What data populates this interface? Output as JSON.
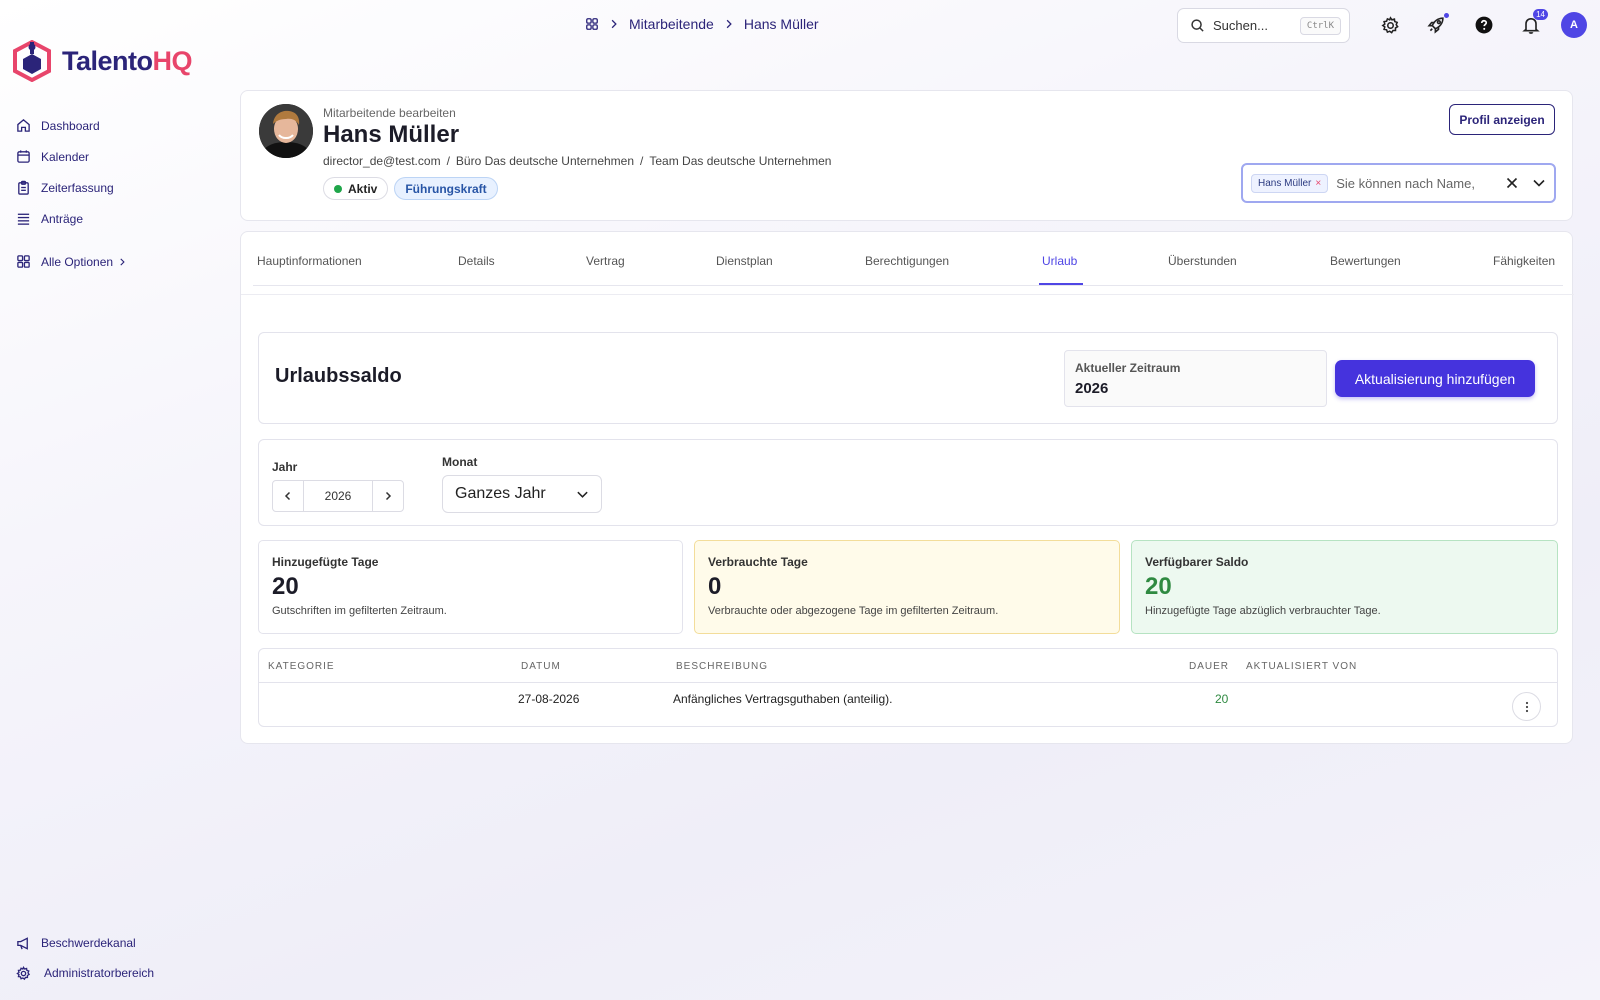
{
  "brand": {
    "name_part1": "Talento",
    "name_part2": "HQ"
  },
  "sidebar": {
    "items": [
      {
        "label": "Dashboard",
        "icon": "home-icon"
      },
      {
        "label": "Kalender",
        "icon": "calendar-icon"
      },
      {
        "label": "Zeiterfassung",
        "icon": "clipboard-icon"
      },
      {
        "label": "Anträge",
        "icon": "list-icon"
      }
    ],
    "all_options": "Alle Optionen",
    "bottom": [
      {
        "label": "Beschwerdekanal",
        "icon": "megaphone-icon"
      },
      {
        "label": "Administratorbereich",
        "icon": "gear-icon"
      }
    ]
  },
  "header": {
    "breadcrumb": [
      "Mitarbeitende",
      "Hans Müller"
    ],
    "search_placeholder": "Suchen...",
    "search_shortcut": "CtrlK",
    "notification_count": "14",
    "avatar_letter": "A"
  },
  "profile": {
    "subtitle": "Mitarbeitende bearbeiten",
    "name": "Hans Müller",
    "email": "director_de@test.com",
    "office": "Büro Das deutsche Unternehmen",
    "team": "Team Das deutsche Unternehmen",
    "meta_sep": "/",
    "status_badge": "Aktiv",
    "role_badge": "Führungskraft",
    "view_profile_label": "Profil anzeigen",
    "picker_chip": "Hans Müller",
    "picker_placeholder": "Sie können nach Name,"
  },
  "tabs": [
    {
      "label": "Hauptinformationen",
      "active": false
    },
    {
      "label": "Details",
      "active": false
    },
    {
      "label": "Vertrag",
      "active": false
    },
    {
      "label": "Dienstplan",
      "active": false
    },
    {
      "label": "Berechtigungen",
      "active": false
    },
    {
      "label": "Urlaub",
      "active": true
    },
    {
      "label": "Überstunden",
      "active": false
    },
    {
      "label": "Bewertungen",
      "active": false
    },
    {
      "label": "Fähigkeiten",
      "active": false
    }
  ],
  "balance": {
    "title": "Urlaubssaldo",
    "period_label": "Aktueller Zeitraum",
    "period_value": "2026",
    "add_button": "Aktualisierung hinzufügen"
  },
  "filters": {
    "year_label": "Jahr",
    "year_value": "2026",
    "month_label": "Monat",
    "month_value": "Ganzes Jahr"
  },
  "stats": {
    "added": {
      "label": "Hinzugefügte Tage",
      "value": "20",
      "desc": "Gutschriften im gefilterten Zeitraum."
    },
    "used": {
      "label": "Verbrauchte Tage",
      "value": "0",
      "desc": "Verbrauchte oder abgezogene Tage im gefilterten Zeitraum."
    },
    "available": {
      "label": "Verfügbarer Saldo",
      "value": "20",
      "desc": "Hinzugefügte Tage abzüglich verbrauchter Tage."
    }
  },
  "table": {
    "headers": [
      "KATEGORIE",
      "DATUM",
      "BESCHREIBUNG",
      "DAUER",
      "AKTUALISIERT VON"
    ],
    "rows": [
      {
        "kategorie": "",
        "datum": "27-08-2026",
        "beschreibung": "Anfängliches Vertragsguthaben (anteilig).",
        "dauer": "20",
        "aktualisiert_von": ""
      }
    ]
  }
}
